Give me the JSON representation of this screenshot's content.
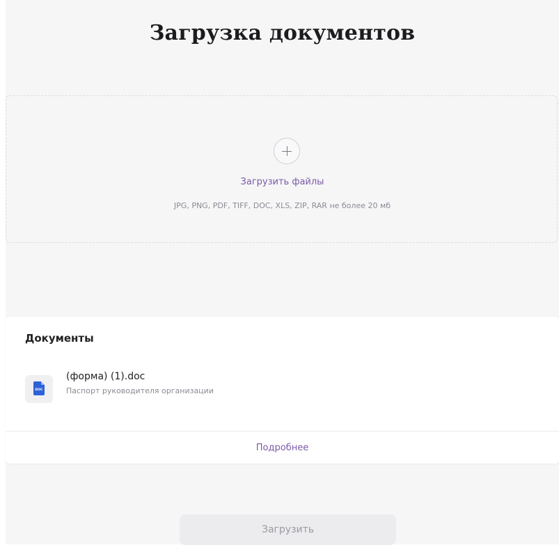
{
  "page": {
    "title": "Загрузка документов"
  },
  "upload": {
    "button_label": "Загрузить файлы",
    "formats_hint": "JPG, PNG, PDF, TIFF, DOC, XLS, ZIP, RAR не более 20 мб",
    "icon": "plus-icon"
  },
  "documents": {
    "heading": "Документы",
    "items": [
      {
        "file_name": "(форма) (1).doc",
        "description": "Паспорт руководителя организации",
        "icon": "doc-file-icon",
        "icon_label": "DOC"
      }
    ],
    "more_label": "Подробнее"
  },
  "footer": {
    "submit_label": "Загрузить"
  },
  "colors": {
    "accent": "#7b5aa6",
    "doc_icon": "#2d62d8",
    "background": "#f6f6f7"
  }
}
